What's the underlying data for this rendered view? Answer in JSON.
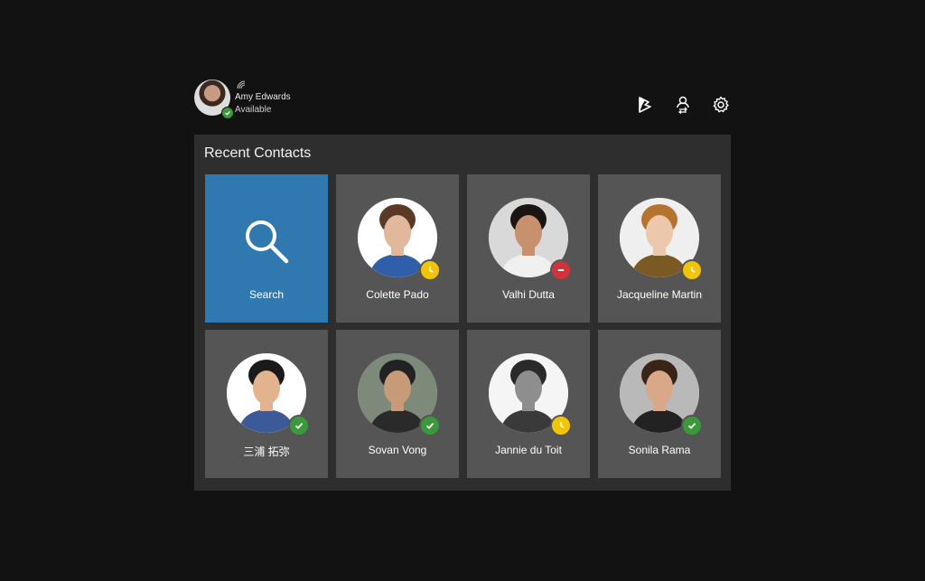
{
  "user": {
    "name": "Amy Edwards",
    "status": "Available",
    "presence": "available",
    "presence_color": "#3a9a3a"
  },
  "header_icons": [
    "dynamics-icon",
    "contact-transfer-icon",
    "settings-gear-icon"
  ],
  "panel": {
    "title": "Recent Contacts"
  },
  "search_tile": {
    "label": "Search",
    "color": "#2f78b0"
  },
  "status_colors": {
    "available": "#3a9a3a",
    "away": "#f2c500",
    "busy": "#d13438"
  },
  "contacts": [
    {
      "name": "Colette Pado",
      "presence": "away",
      "skin": "#e2b89c",
      "hair": "#5a3a26",
      "bg": "#ffffff",
      "shirt": "#2e5fa8"
    },
    {
      "name": "Valhi Dutta",
      "presence": "busy",
      "skin": "#c8916e",
      "hair": "#1a1412",
      "bg": "#d9d9d9",
      "shirt": "#f0f0f0"
    },
    {
      "name": "Jacqueline Martin",
      "presence": "away",
      "skin": "#ecc7ab",
      "hair": "#b5742e",
      "bg": "#efefef",
      "shirt": "#7a5a22"
    },
    {
      "name": "三浦 拓弥",
      "presence": "available",
      "skin": "#e2b38c",
      "hair": "#1a1a1a",
      "bg": "#ffffff",
      "shirt": "#3d5a98"
    },
    {
      "name": "Sovan Vong",
      "presence": "available",
      "skin": "#c79a78",
      "hair": "#222222",
      "bg": "#7d8a7a",
      "shirt": "#2a2a2a"
    },
    {
      "name": "Jannie du Toit",
      "presence": "away",
      "skin": "#8e8e8e",
      "hair": "#2a2a2a",
      "bg": "#f5f5f5",
      "shirt": "#3a3a3a"
    },
    {
      "name": "Sonila Rama",
      "presence": "available",
      "skin": "#d8a888",
      "hair": "#3a2418",
      "bg": "#b9b9b9",
      "shirt": "#222222"
    }
  ]
}
